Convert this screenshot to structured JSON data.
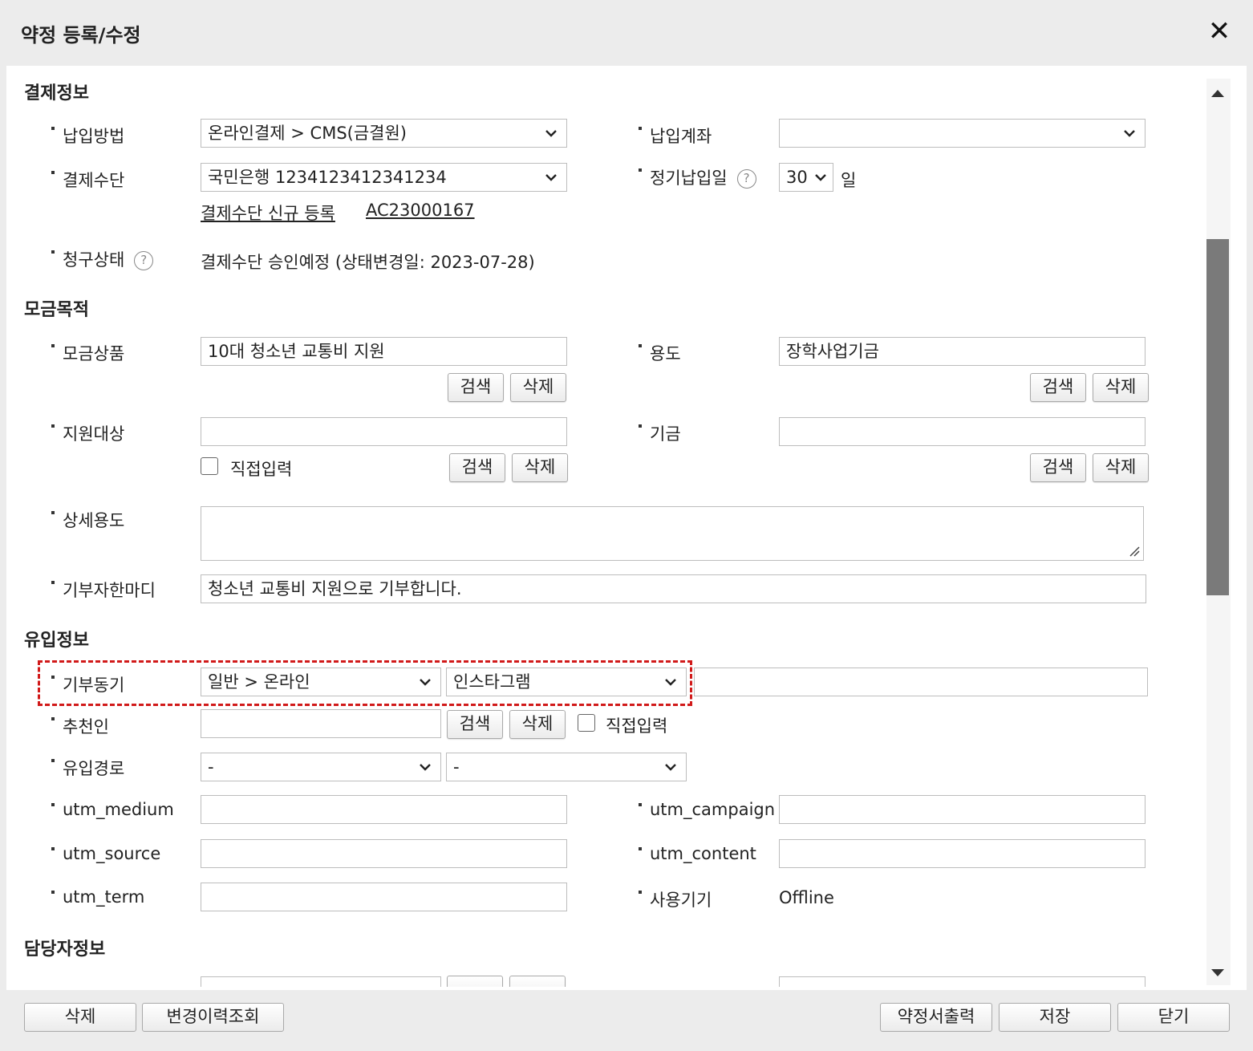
{
  "dialog": {
    "title": "약정 등록/수정",
    "close_glyph": "✕"
  },
  "payment": {
    "section_title": "결제정보",
    "method_label": "납입방법",
    "method_value": "온라인결제 > CMS(금결원)",
    "account_label": "납입계좌",
    "account_value": "",
    "means_label": "결제수단",
    "means_value": "국민은행 1234123412341234",
    "regular_day_label": "정기납입일",
    "regular_day_value": "30",
    "day_unit": "일",
    "new_means_link": "결제수단 신규 등록",
    "means_code_link": "AC23000167",
    "billing_status_label": "청구상태",
    "billing_status_value": "결제수단 승인예정 (상태변경일: 2023-07-28)"
  },
  "purpose": {
    "section_title": "모금목적",
    "product_label": "모금상품",
    "product_value": "10대 청소년 교통비 지원",
    "usage_label": "용도",
    "usage_value": "장학사업기금",
    "target_label": "지원대상",
    "target_value": "",
    "direct_input_label": "직접입력",
    "fund_label": "기금",
    "fund_value": "",
    "detail_usage_label": "상세용도",
    "donor_message_label": "기부자한마디",
    "donor_message_value": "청소년 교통비 지원으로 기부합니다.",
    "search_label": "검색",
    "delete_label": "삭제"
  },
  "inflow": {
    "section_title": "유입정보",
    "motive_label": "기부동기",
    "motive_value1": "일반 > 온라인",
    "motive_value2": "인스타그램",
    "motive_text": "",
    "referrer_label": "추천인",
    "referrer_value": "",
    "direct_input_label": "직접입력",
    "route_label": "유입경로",
    "route_value1": "-",
    "route_value2": "-",
    "utm_medium_label": "utm_medium",
    "utm_campaign_label": "utm_campaign",
    "utm_source_label": "utm_source",
    "utm_content_label": "utm_content",
    "utm_term_label": "utm_term",
    "device_label": "사용기기",
    "device_value": "Offline",
    "search_label": "검색",
    "delete_label": "삭제"
  },
  "manager": {
    "section_title": "담당자정보"
  },
  "footer": {
    "delete_label": "삭제",
    "history_label": "변경이력조회",
    "print_label": "약정서출력",
    "save_label": "저장",
    "close_label": "닫기"
  },
  "colors": {
    "highlight": "#d11a1a",
    "scroll_thumb": "#7a7a7a"
  }
}
